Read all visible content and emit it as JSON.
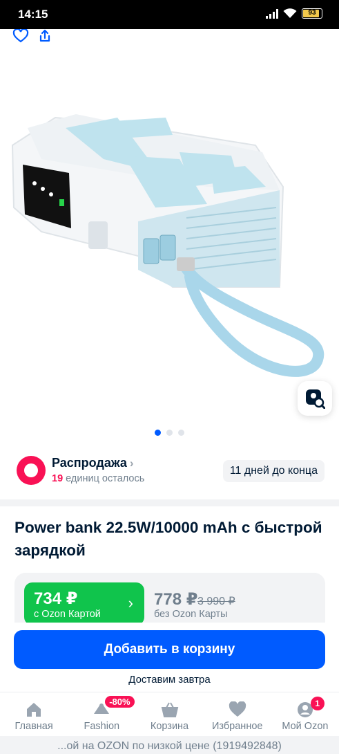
{
  "status_bar": {
    "time": "14:15",
    "battery": "93"
  },
  "sale": {
    "title": "Распродажа",
    "remaining_count": "19",
    "remaining_text": "единиц осталось",
    "days_left": "11 дней до конца"
  },
  "gallery": {
    "count": 3,
    "active_index": 0
  },
  "product": {
    "title": "Power bank 22.5W/10000 mAh с быстрой зарядкой"
  },
  "price": {
    "ozon_card_price": "734 ₽",
    "ozon_card_label": "с Ozon Картой",
    "regular_price": "778 ₽",
    "old_price": "3 990 ₽",
    "regular_label": "без Ozon Карты"
  },
  "cart": {
    "button_label": "Добавить в корзину",
    "delivery_text": "Доставим завтра"
  },
  "nav": {
    "items": [
      {
        "label": "Главная",
        "icon": "home-icon"
      },
      {
        "label": "Fashion",
        "icon": "fashion-icon",
        "badge": "-80%"
      },
      {
        "label": "Корзина",
        "icon": "cart-icon"
      },
      {
        "label": "Избранное",
        "icon": "heart-icon"
      },
      {
        "label": "Мой Ozon",
        "icon": "profile-icon",
        "badge": "1"
      }
    ]
  },
  "footer": {
    "text": "...ой на OZON по низкой цене (1919492848)"
  },
  "colors": {
    "accent": "#005bff",
    "sale": "#f91155",
    "ozon_card": "#10c44c"
  }
}
